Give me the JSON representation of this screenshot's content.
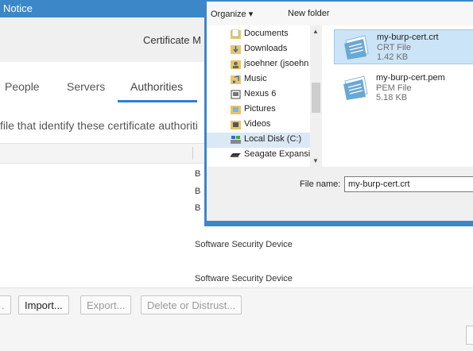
{
  "background_window": {
    "title": "Notice"
  },
  "cert_manager": {
    "title": "Certificate M",
    "tabs": [
      "People",
      "Servers",
      "Authorities"
    ],
    "active_tab": "Authorities",
    "description": "file that identify these certificate authoriti",
    "rows": {
      "letters": [
        "B",
        "B",
        "B"
      ],
      "devices": [
        "Software Security Device",
        "Software Security Device"
      ]
    },
    "buttons": {
      "partial": ".",
      "import": "Import...",
      "export": "Export...",
      "delete": "Delete or Distrust..."
    }
  },
  "file_dialog": {
    "toolbar": {
      "organize": "Organize ▾",
      "new_folder": "New folder"
    },
    "nav": [
      {
        "label": "Documents",
        "icon": "documents-icon"
      },
      {
        "label": "Downloads",
        "icon": "downloads-icon"
      },
      {
        "label": "jsoehner (jsoehn",
        "icon": "user-folder-icon"
      },
      {
        "label": "Music",
        "icon": "music-icon"
      },
      {
        "label": "Nexus 6",
        "icon": "device-icon"
      },
      {
        "label": "Pictures",
        "icon": "pictures-icon"
      },
      {
        "label": "Videos",
        "icon": "videos-icon"
      },
      {
        "label": "Local Disk (C:)",
        "icon": "disk-icon"
      },
      {
        "label": "Seagate Expansio",
        "icon": "drive-icon"
      }
    ],
    "selected_nav": "Local Disk (C:)",
    "files": [
      {
        "name": "my-burp-cert.crt",
        "type": "CRT File",
        "size": "1.42 KB",
        "selected": true
      },
      {
        "name": "my-burp-cert.pem",
        "type": "PEM File",
        "size": "5.18 KB",
        "selected": false
      }
    ],
    "file_name_label": "File name:",
    "file_name_value": "my-burp-cert.crt"
  },
  "colors": {
    "title_blue": "#3c87c8",
    "accent": "#2b7fd6",
    "selected_file": "#cce4f7"
  }
}
